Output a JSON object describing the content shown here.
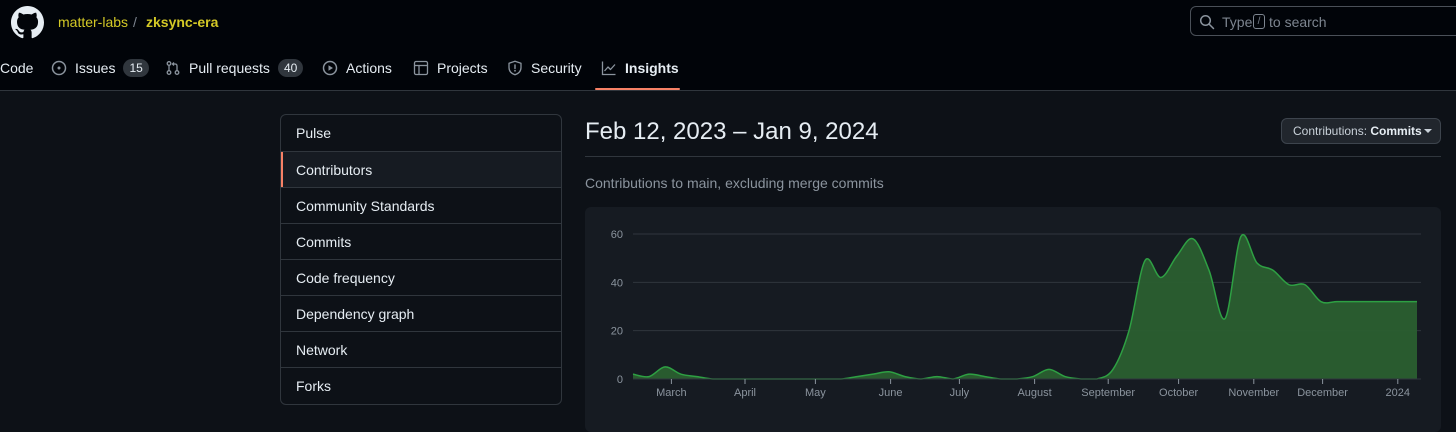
{
  "header": {
    "owner": "matter-labs",
    "separator": "/",
    "repo": "zksync-era",
    "search": {
      "prefix": "Type",
      "key": "/",
      "suffix": "to search"
    }
  },
  "tabs": [
    {
      "label": "Code",
      "icon": "code-icon"
    },
    {
      "label": "Issues",
      "icon": "issue-opened-icon",
      "count": "15"
    },
    {
      "label": "Pull requests",
      "icon": "git-pull-request-icon",
      "count": "40"
    },
    {
      "label": "Actions",
      "icon": "play-icon"
    },
    {
      "label": "Projects",
      "icon": "table-icon"
    },
    {
      "label": "Security",
      "icon": "shield-icon"
    },
    {
      "label": "Insights",
      "icon": "graph-icon",
      "selected": true
    }
  ],
  "sidebar": {
    "items": [
      {
        "label": "Pulse"
      },
      {
        "label": "Contributors",
        "selected": true
      },
      {
        "label": "Community Standards"
      },
      {
        "label": "Commits"
      },
      {
        "label": "Code frequency"
      },
      {
        "label": "Dependency graph"
      },
      {
        "label": "Network"
      },
      {
        "label": "Forks"
      }
    ]
  },
  "main": {
    "date_range": "Feb 12, 2023 – Jan 9, 2024",
    "contributions_button": {
      "prefix": "Contributions:",
      "value": "Commits"
    },
    "subtitle": "Contributions to main, excluding merge commits"
  },
  "colors": {
    "accent": "#f78166",
    "brand": "#d4c926",
    "chart_fill": "#2a5f30",
    "chart_line": "#2ea043"
  },
  "chart_data": {
    "type": "area",
    "title": "",
    "xlabel": "",
    "ylabel": "",
    "ylim": [
      0,
      60
    ],
    "yticks": [
      0,
      20,
      40,
      60
    ],
    "grid": true,
    "xtick_labels": [
      {
        "label": "March",
        "week": 2.4
      },
      {
        "label": "April",
        "week": 7.0
      },
      {
        "label": "May",
        "week": 11.4
      },
      {
        "label": "June",
        "week": 16.1
      },
      {
        "label": "July",
        "week": 20.4
      },
      {
        "label": "August",
        "week": 25.1
      },
      {
        "label": "September",
        "week": 29.7
      },
      {
        "label": "October",
        "week": 34.1
      },
      {
        "label": "November",
        "week": 38.8
      },
      {
        "label": "December",
        "week": 43.1
      },
      {
        "label": "2024",
        "week": 47.8
      }
    ],
    "series": [
      {
        "x": [
          0,
          1,
          2,
          3,
          4,
          5,
          6,
          7,
          8,
          9,
          10,
          11,
          12,
          13,
          14,
          15,
          16,
          17,
          18,
          19,
          20,
          21,
          22,
          23,
          24,
          25,
          26,
          27,
          28,
          29,
          30,
          31,
          32,
          33,
          34,
          35,
          36,
          37,
          38,
          39,
          40,
          41,
          42,
          43,
          44,
          45,
          46,
          47,
          48,
          49
        ],
        "values": [
          2,
          1,
          5,
          2,
          1,
          0,
          0,
          0,
          0,
          0,
          0,
          0,
          0,
          0,
          1,
          2,
          3,
          1,
          0,
          1,
          0,
          2,
          1,
          0,
          0,
          1,
          4,
          1,
          0,
          0,
          4,
          20,
          49,
          42,
          51,
          58,
          45,
          25,
          59,
          48,
          45,
          39,
          39,
          32,
          32,
          32,
          32,
          32,
          32,
          32
        ]
      }
    ]
  }
}
